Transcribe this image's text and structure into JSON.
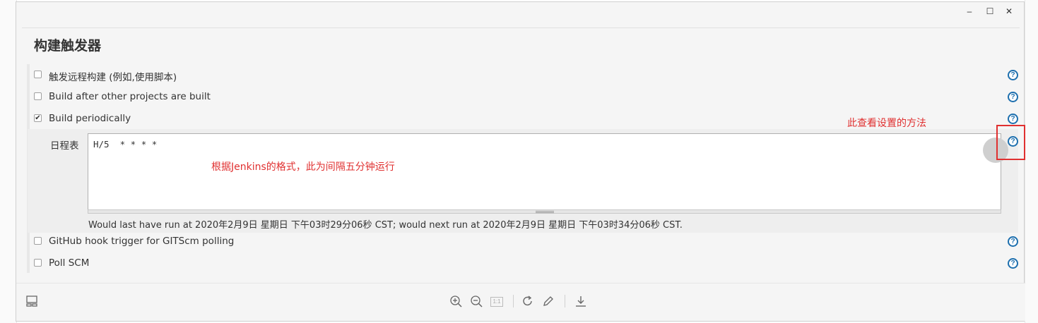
{
  "window": {
    "min_glyph": "–",
    "max_glyph": "☐",
    "close_glyph": "✕"
  },
  "section": {
    "title": "构建触发器"
  },
  "triggers": [
    {
      "label": "触发远程构建 (例如,使用脚本)",
      "checked": false
    },
    {
      "label": "Build after other projects are built",
      "checked": false
    },
    {
      "label": "Build periodically",
      "checked": true
    },
    {
      "label": "GitHub hook trigger for GITScm polling",
      "checked": false
    },
    {
      "label": "Poll SCM",
      "checked": false
    }
  ],
  "schedule": {
    "label": "日程表",
    "value": "H/5  * * * *",
    "note": "Would last have run at 2020年2月9日 星期日 下午03时29分06秒 CST; would next run at 2020年2月9日 星期日 下午03时34分06秒 CST."
  },
  "annotations": {
    "help_hint": "此查看设置的方法",
    "format_hint": "根据Jenkins的格式，此为间隔五分钟运行"
  },
  "toolbar": {
    "icons": [
      "layout-icon",
      "zoom-in-icon",
      "zoom-out-icon",
      "actual-size-icon",
      "rotate-icon",
      "edit-icon",
      "download-icon"
    ],
    "actual_size_label": "1:1"
  },
  "colors": {
    "annotation": "#e03030",
    "help": "#1d6fae"
  }
}
